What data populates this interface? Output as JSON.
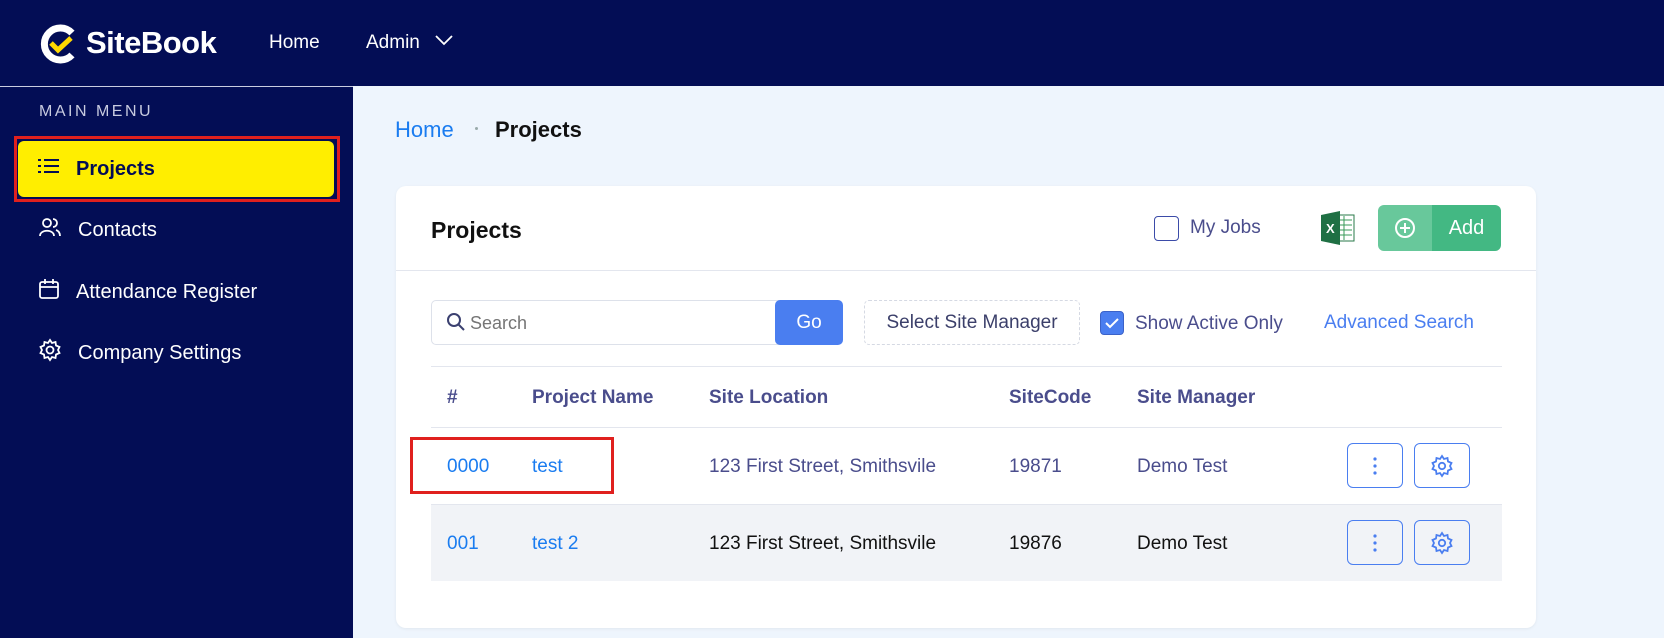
{
  "header": {
    "brand": "SiteBook",
    "nav": [
      {
        "label": "Home"
      },
      {
        "label": "Admin"
      }
    ]
  },
  "sidebar": {
    "section": "MAIN MENU",
    "items": [
      {
        "label": "Projects",
        "icon": "list-icon",
        "active": true
      },
      {
        "label": "Contacts",
        "icon": "users-icon"
      },
      {
        "label": "Attendance Register",
        "icon": "calendar-icon"
      },
      {
        "label": "Company Settings",
        "icon": "gear-icon"
      }
    ]
  },
  "breadcrumb": {
    "home": "Home",
    "current": "Projects"
  },
  "card": {
    "title": "Projects",
    "my_jobs": "My Jobs",
    "my_jobs_checked": false,
    "add_label": "Add",
    "search": {
      "placeholder": "Search",
      "go": "Go",
      "site_manager": "Select Site Manager",
      "show_active": "Show Active Only",
      "show_active_checked": true,
      "advanced": "Advanced Search"
    },
    "columns": [
      "#",
      "Project Name",
      "Site Location",
      "SiteCode",
      "Site Manager"
    ],
    "rows": [
      {
        "num": "0000",
        "name": "test",
        "location": "123 First Street, Smithsvile",
        "code": "19871",
        "manager": "Demo Test"
      },
      {
        "num": "001",
        "name": "test 2",
        "location": "123 First Street, Smithsvile",
        "code": "19876",
        "manager": "Demo Test"
      }
    ]
  },
  "colors": {
    "navy": "#030d55",
    "accent": "#ffee00",
    "green": "#43b883",
    "blue": "#4a7ef0"
  }
}
